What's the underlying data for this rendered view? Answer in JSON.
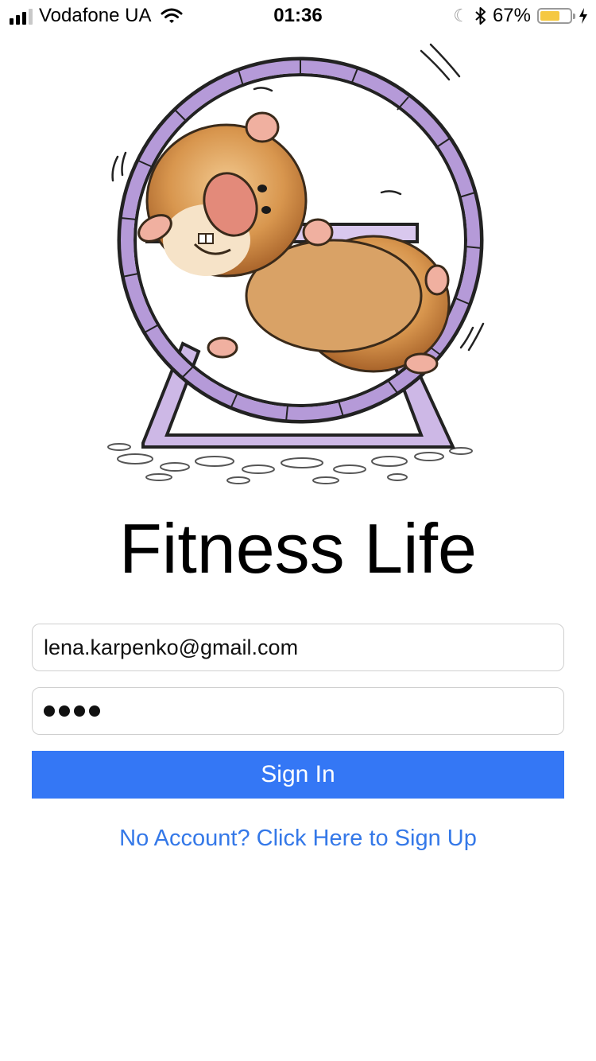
{
  "status_bar": {
    "carrier": "Vodafone UA",
    "time": "01:36",
    "battery_percent": "67%",
    "battery_level": 0.67,
    "icons": [
      "signal-icon",
      "wifi-icon",
      "moon-icon",
      "bluetooth-icon",
      "battery-icon",
      "charging-icon"
    ]
  },
  "illustration": {
    "subject": "hamster-in-wheel"
  },
  "app": {
    "title": "Fitness Life"
  },
  "form": {
    "email_value": "lena.karpenko@gmail.com",
    "password_mask": "••••",
    "sign_in_label": "Sign In",
    "sign_up_link": "No Account? Click Here to Sign Up"
  },
  "colors": {
    "accent": "#3477f5",
    "link": "#3478e8",
    "battery": "#f5c842"
  }
}
